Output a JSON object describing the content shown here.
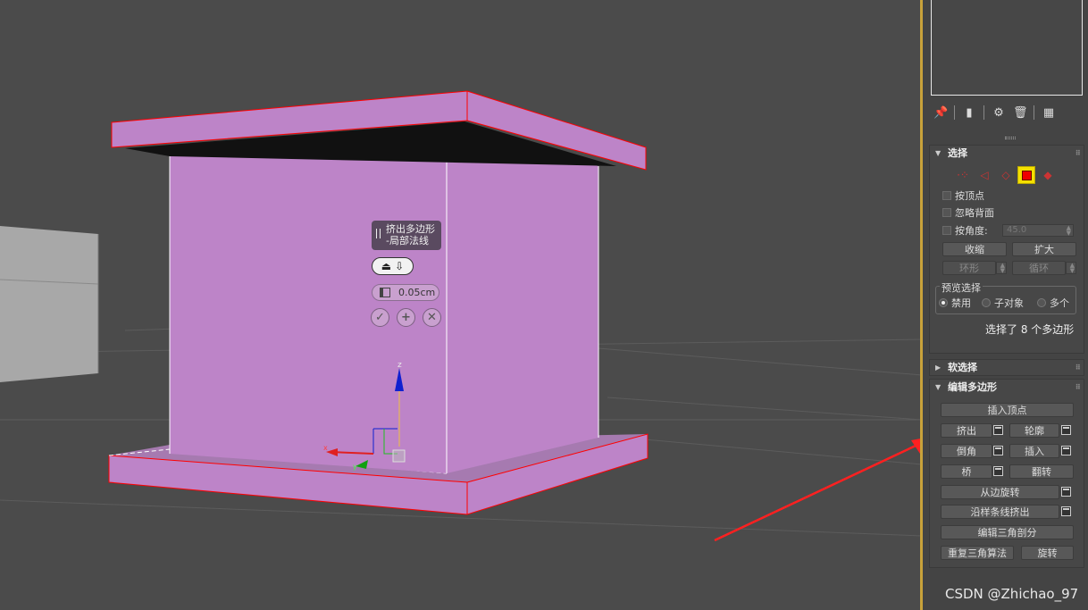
{
  "caddy": {
    "title_line1": "挤出多边形",
    "title_line2": "-局部法线",
    "amount": "0.05cm"
  },
  "gizmo": {
    "axis_z": "z",
    "axis_x": "x",
    "axis_y": "y"
  },
  "panel": {
    "selection": {
      "title": "选择",
      "by_vertex": "按顶点",
      "ignore_backfacing": "忽略背面",
      "by_angle": "按角度:",
      "angle_value": "45.0",
      "shrink": "收缩",
      "grow": "扩大",
      "ring": "环形",
      "loop": "循环",
      "preview_title": "预览选择",
      "preview_off": "禁用",
      "preview_subobj": "子对象",
      "preview_multi": "多个",
      "status": "选择了 8 个多边形"
    },
    "soft_selection": {
      "title": "软选择"
    },
    "edit_polygons": {
      "title": "编辑多边形",
      "insert_vertex": "插入顶点",
      "extrude": "挤出",
      "outline": "轮廓",
      "bevel": "倒角",
      "inset": "插入",
      "bridge": "桥",
      "flip": "翻转",
      "hinge_from_edge": "从边旋转",
      "extrude_along_spline": "沿样条线挤出",
      "edit_triangulation": "编辑三角剖分",
      "retriangulate": "重复三角算法",
      "turn": "旋转"
    }
  },
  "watermark": "CSDN @Zhichao_97",
  "colors": {
    "viewport_bg": "#4b4b4b",
    "selected_face": "#bd84c8",
    "selection_edge": "#ff0000",
    "panel_bg": "#444444",
    "active_subobject": "#f5e000",
    "annotation_arrow": "#ff2020"
  }
}
